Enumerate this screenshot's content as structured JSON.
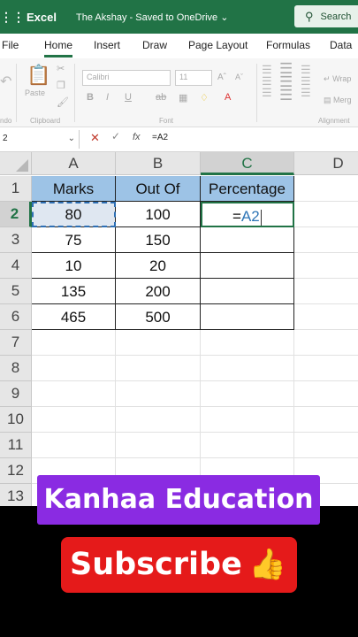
{
  "titlebar": {
    "app_name": "Excel",
    "doc_title": "The Akshay  -  Saved to OneDrive ⌄",
    "search_label": "Search",
    "bg_color": "#217346"
  },
  "tabs": [
    "File",
    "Home",
    "Insert",
    "Draw",
    "Page Layout",
    "Formulas",
    "Data"
  ],
  "active_tab": "Home",
  "ribbon": {
    "paste_label": "Paste",
    "clipboard_label": "Clipboard",
    "font_name": "Calibri",
    "font_size": "11",
    "font_label": "Font",
    "wrap_label": "Wrap",
    "merge_label": "Merg",
    "alignment_label": "Alignment",
    "undo_label": "ndo",
    "bold": "B",
    "italic": "I",
    "underline": "U",
    "strike": "ab"
  },
  "formula_bar": {
    "name_box": "2",
    "cancel_icon": "✕",
    "fx_label": "fx",
    "formula": "=A2"
  },
  "columns": [
    "A",
    "B",
    "C",
    "D"
  ],
  "selected_column": "C",
  "rows": [
    "1",
    "2",
    "3",
    "4",
    "5",
    "6",
    "7",
    "8",
    "9",
    "10",
    "11",
    "12",
    "13"
  ],
  "selected_row": "2",
  "table": {
    "headers": [
      "Marks",
      "Out Of",
      "Percentage"
    ],
    "data": [
      [
        "80",
        "100"
      ],
      [
        "75",
        "150"
      ],
      [
        "10",
        "20"
      ],
      [
        "135",
        "200"
      ],
      [
        "465",
        "500"
      ]
    ],
    "active_cell_prefix": "=",
    "active_cell_ref": "A2"
  },
  "banners": {
    "channel": "Kanhaa Education",
    "subscribe": "Subscribe",
    "thumb": "👍"
  }
}
